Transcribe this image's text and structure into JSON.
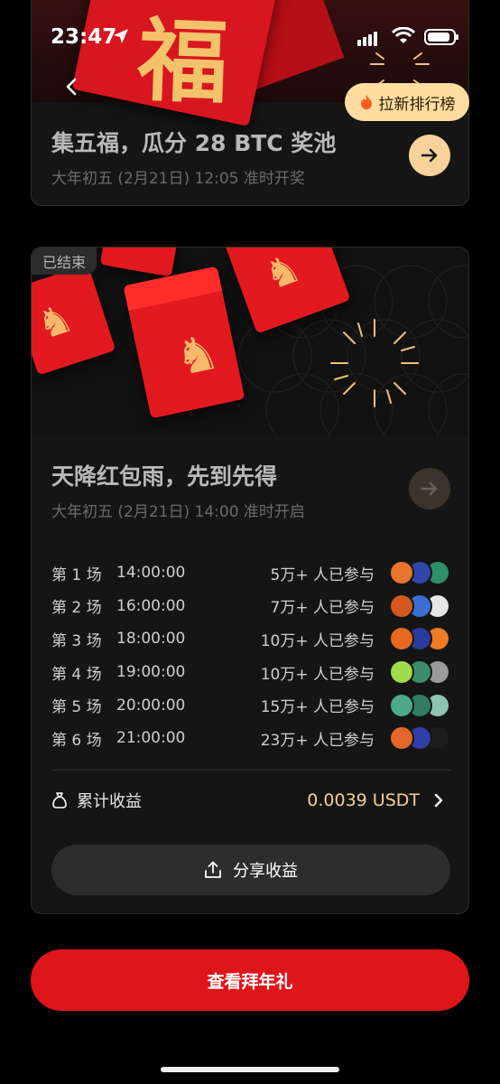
{
  "status_bar": {
    "time": "23:47"
  },
  "card1": {
    "banner_glyph": "福",
    "leaderboard_label": "拉新排行榜",
    "title": "集五福，瓜分 28 BTC 奖池",
    "subtitle": "大年初五 (2月21日) 12:05 准时开奖"
  },
  "card2": {
    "ended_badge": "已结束",
    "title": "天降红包雨，先到先得",
    "subtitle": "大年初五 (2月21日) 14:00 准时开启",
    "sessions": [
      {
        "label": "第 1 场",
        "time": "14:00:00",
        "count": "5万+ 人已参与",
        "avatar_colors": [
          "#e8762a",
          "#3046a8",
          "#2e8f6b"
        ]
      },
      {
        "label": "第 2 场",
        "time": "16:00:00",
        "count": "7万+ 人已参与",
        "avatar_colors": [
          "#d2581f",
          "#3a6fd0",
          "#e6e6e6"
        ]
      },
      {
        "label": "第 3 场",
        "time": "18:00:00",
        "count": "10万+ 人已参与",
        "avatar_colors": [
          "#e56a1f",
          "#2b3a9c",
          "#ef7b24"
        ]
      },
      {
        "label": "第 4 场",
        "time": "19:00:00",
        "count": "10万+ 人已参与",
        "avatar_colors": [
          "#9fdc4a",
          "#3e8d6a",
          "#9a9a9a"
        ]
      },
      {
        "label": "第 5 场",
        "time": "20:00:00",
        "count": "15万+ 人已参与",
        "avatar_colors": [
          "#4ea88a",
          "#2f7c62",
          "#8dc5b2"
        ]
      },
      {
        "label": "第 6 场",
        "time": "21:00:00",
        "count": "23万+ 人已参与",
        "avatar_colors": [
          "#e4682a",
          "#2f3fa6",
          "#1d1d1d"
        ]
      }
    ],
    "earnings_label": "累计收益",
    "earnings_value": "0.0039 USDT",
    "share_label": "分享收益"
  },
  "main_button_label": "查看拜年礼",
  "colors": {
    "accent_red": "#de1519",
    "gold": "#f5cf97",
    "leaderboard_bg": "#ffdca0"
  }
}
